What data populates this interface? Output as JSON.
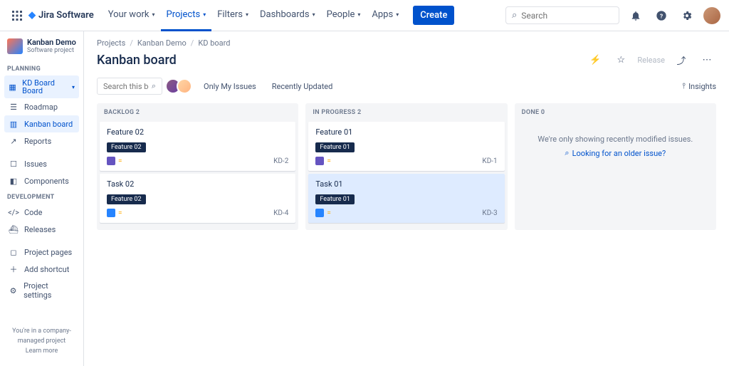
{
  "topnav": {
    "product": "Jira Software",
    "items": [
      "Your work",
      "Projects",
      "Filters",
      "Dashboards",
      "People",
      "Apps"
    ],
    "active_index": 1,
    "create": "Create",
    "search_placeholder": "Search"
  },
  "project": {
    "name": "Kanban Demo",
    "subtitle": "Software project"
  },
  "sidebar": {
    "section_planning": "PLANNING",
    "kd_board": "KD Board Board",
    "roadmap": "Roadmap",
    "kanban": "Kanban board",
    "reports": "Reports",
    "issues": "Issues",
    "components": "Components",
    "section_development": "DEVELOPMENT",
    "code": "Code",
    "releases": "Releases",
    "project_pages": "Project pages",
    "add_shortcut": "Add shortcut",
    "project_settings": "Project settings",
    "footer_line": "You're in a company-managed project",
    "footer_link": "Learn more"
  },
  "breadcrumbs": [
    "Projects",
    "Kanban Demo",
    "KD board"
  ],
  "page_title": "Kanban board",
  "head_actions": {
    "release": "Release"
  },
  "toolbar": {
    "search_placeholder": "Search this board",
    "only_my": "Only My Issues",
    "recently": "Recently Updated",
    "insights": "Insights"
  },
  "columns": [
    {
      "title": "BACKLOG 2",
      "cards": [
        {
          "title": "Feature 02",
          "epic": "Feature 02",
          "type": "story",
          "key": "KD-2",
          "selected": false
        },
        {
          "title": "Task 02",
          "epic": "Feature 02",
          "type": "task",
          "key": "KD-4",
          "selected": false
        }
      ]
    },
    {
      "title": "IN PROGRESS 2",
      "cards": [
        {
          "title": "Feature 01",
          "epic": "Feature 01",
          "type": "story",
          "key": "KD-1",
          "selected": false
        },
        {
          "title": "Task 01",
          "epic": "Feature 01",
          "type": "task",
          "key": "KD-3",
          "selected": true
        }
      ]
    },
    {
      "title": "DONE 0",
      "empty_msg": "We're only showing recently modified issues.",
      "empty_link": "Looking for an older issue?"
    }
  ]
}
